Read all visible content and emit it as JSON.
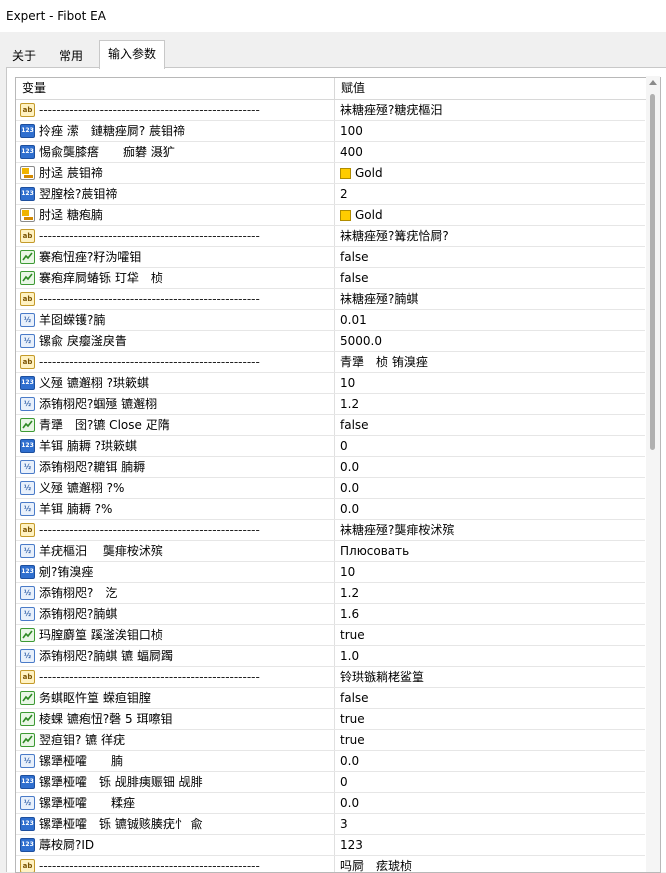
{
  "window": {
    "title": "Expert - Fibot EA"
  },
  "tabs": [
    "关于",
    "常用",
    "输入参数"
  ],
  "table": {
    "headers": {
      "variable": "变量",
      "value": "赋值"
    },
    "rows": [
      {
        "type": "ab",
        "name": "---------------------------------------------------",
        "value": "袜糖痤殛?糖疣樞汨"
      },
      {
        "type": "int",
        "name": "拎痤 潆　鏈糖痤屙? 莀钼禘",
        "value": "100"
      },
      {
        "type": "int",
        "name": "惕兪龑膝瘩　　痂礬 滠犷",
        "value": "400"
      },
      {
        "type": "clr",
        "name": "肘迳 莀钼禘",
        "value": "Gold",
        "swatch": "#ffcc00"
      },
      {
        "type": "int",
        "name": "翌膣桧?莀钼禘",
        "value": "2"
      },
      {
        "type": "clr",
        "name": "肘迳 糖疱腩",
        "value": "Gold",
        "swatch": "#ffcc00"
      },
      {
        "type": "ab",
        "name": "---------------------------------------------------",
        "value": "袜糖痤殛?篝疣恰屙?"
      },
      {
        "type": "bool",
        "name": "褰疱忸痤?籽沩嚯钼",
        "value": "false"
      },
      {
        "type": "bool",
        "name": "褰疱痒屙蝽铄 玎牮　桢",
        "value": "false"
      },
      {
        "type": "ab",
        "name": "---------------------------------------------------",
        "value": "袜糖痤殛?腩蜞"
      },
      {
        "type": "dbl",
        "name": "羊囵蝾镬?腩",
        "value": "0.01"
      },
      {
        "type": "dbl",
        "name": "镙兪 戾瘿滏戾眚",
        "value": "5000.0"
      },
      {
        "type": "ab",
        "name": "---------------------------------------------------",
        "value": "青犟　桢 铕溴痤"
      },
      {
        "type": "int",
        "name": "义殛 镳邂栩 ?珙簌蜞",
        "value": "10"
      },
      {
        "type": "dbl",
        "name": "添铕栩咫?蝈殛 镳邂栩",
        "value": "1.2"
      },
      {
        "type": "bool",
        "name": "青犟　囹?镳 Close 疋隋",
        "value": "false"
      },
      {
        "type": "int",
        "name": "羊铒 腩耨 ?珙簌蜞",
        "value": "0"
      },
      {
        "type": "dbl",
        "name": "添铕栩咫?耱铒 腩耨",
        "value": "0.0"
      },
      {
        "type": "dbl",
        "name": "义殛 镳邂栩 ?%",
        "value": "0.0"
      },
      {
        "type": "dbl",
        "name": "羊铒 腩耨 ?%",
        "value": "0.0"
      },
      {
        "type": "ab",
        "name": "---------------------------------------------------",
        "value": "袜糖痤殛?龑痱桉沭殡"
      },
      {
        "type": "dbl",
        "name": "羊疣樞汨　 龑痱桉沭殡",
        "value": "Плюсовать"
      },
      {
        "type": "int",
        "name": "剜?铕溴痤",
        "value": "10"
      },
      {
        "type": "dbl",
        "name": "添铕栩咫?　汔",
        "value": "1.2"
      },
      {
        "type": "dbl",
        "name": "添铕栩咫?腩蜞",
        "value": "1.6"
      },
      {
        "type": "bool",
        "name": "玛膣麝篁 蹊滏涘钼口桢",
        "value": "true"
      },
      {
        "type": "dbl",
        "name": "添铕栩咫?腩蜞 镳 蝠屙躅",
        "value": "1.0"
      },
      {
        "type": "ab",
        "name": "---------------------------------------------------",
        "value": "铃珙镞耥栳鲨篁"
      },
      {
        "type": "bool",
        "name": "务蜞眍忤篁 蝾疸钼膣",
        "value": "false"
      },
      {
        "type": "bool",
        "name": "棱蜾 镳疱忸?磬 5 珥嚓钼",
        "value": "true"
      },
      {
        "type": "bool",
        "name": "翌疸钼? 镳 徉疣",
        "value": "true"
      },
      {
        "type": "dbl",
        "name": "镙犟桠嚯　　腩",
        "value": "0.0"
      },
      {
        "type": "int",
        "name": "镙犟桠嚯　铄 觇腓痍赈钿 觇腓",
        "value": "0"
      },
      {
        "type": "dbl",
        "name": "镙犟桠嚯　　糅痤",
        "value": "0.0"
      },
      {
        "type": "int",
        "name": "镙犟桠嚯　铄 镳铖赅腠疣忄 兪",
        "value": "3"
      },
      {
        "type": "int",
        "name": "蓐桉屙?ID",
        "value": "123"
      },
      {
        "type": "ab",
        "name": "---------------------------------------------------",
        "value": "吗屙　痃琥桢"
      }
    ]
  },
  "icons": {
    "ab": "string-param-icon",
    "int": "integer-param-icon",
    "dbl": "double-param-icon",
    "bool": "boolean-param-icon",
    "clr": "color-param-icon"
  }
}
